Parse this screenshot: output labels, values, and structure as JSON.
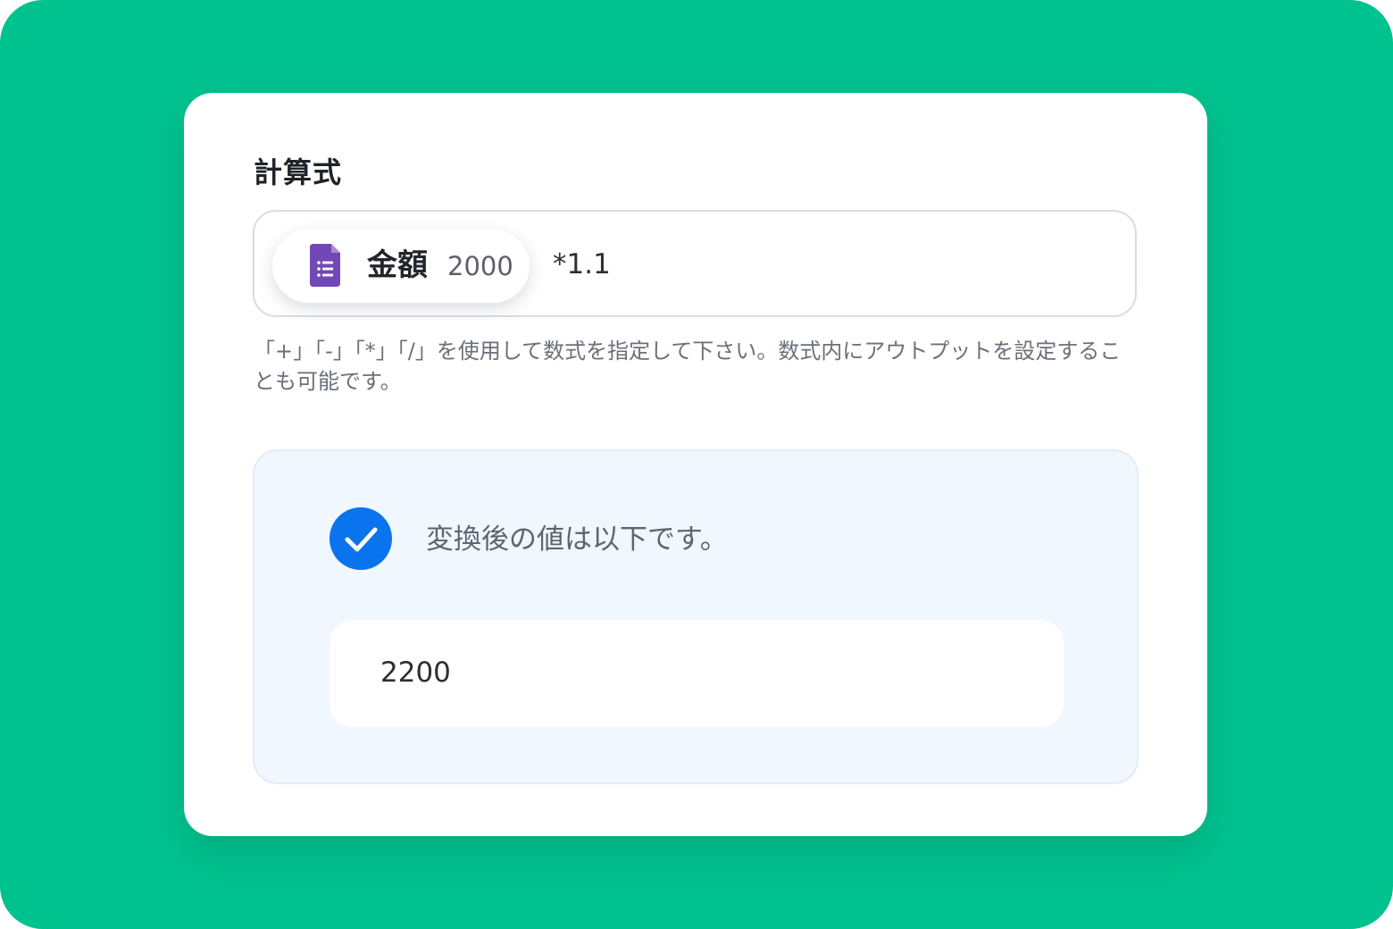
{
  "formula_section": {
    "label": "計算式",
    "output_chip": {
      "icon": "google-forms-icon",
      "name": "金額",
      "value": "2000"
    },
    "formula_suffix": "*1.1",
    "hint": "「+」「-」「*」「/」を使用して数式を指定して下さい。数式内にアウトプットを設定することも可能です。"
  },
  "result": {
    "icon": "check-circle-icon",
    "message": "変換後の値は以下です。",
    "value": "2200"
  },
  "colors": {
    "background": "#00c28f",
    "card": "#ffffff",
    "accent_blue": "#0a74ee",
    "forms_purple": "#7248b9",
    "result_panel": "#f0f7ff"
  }
}
